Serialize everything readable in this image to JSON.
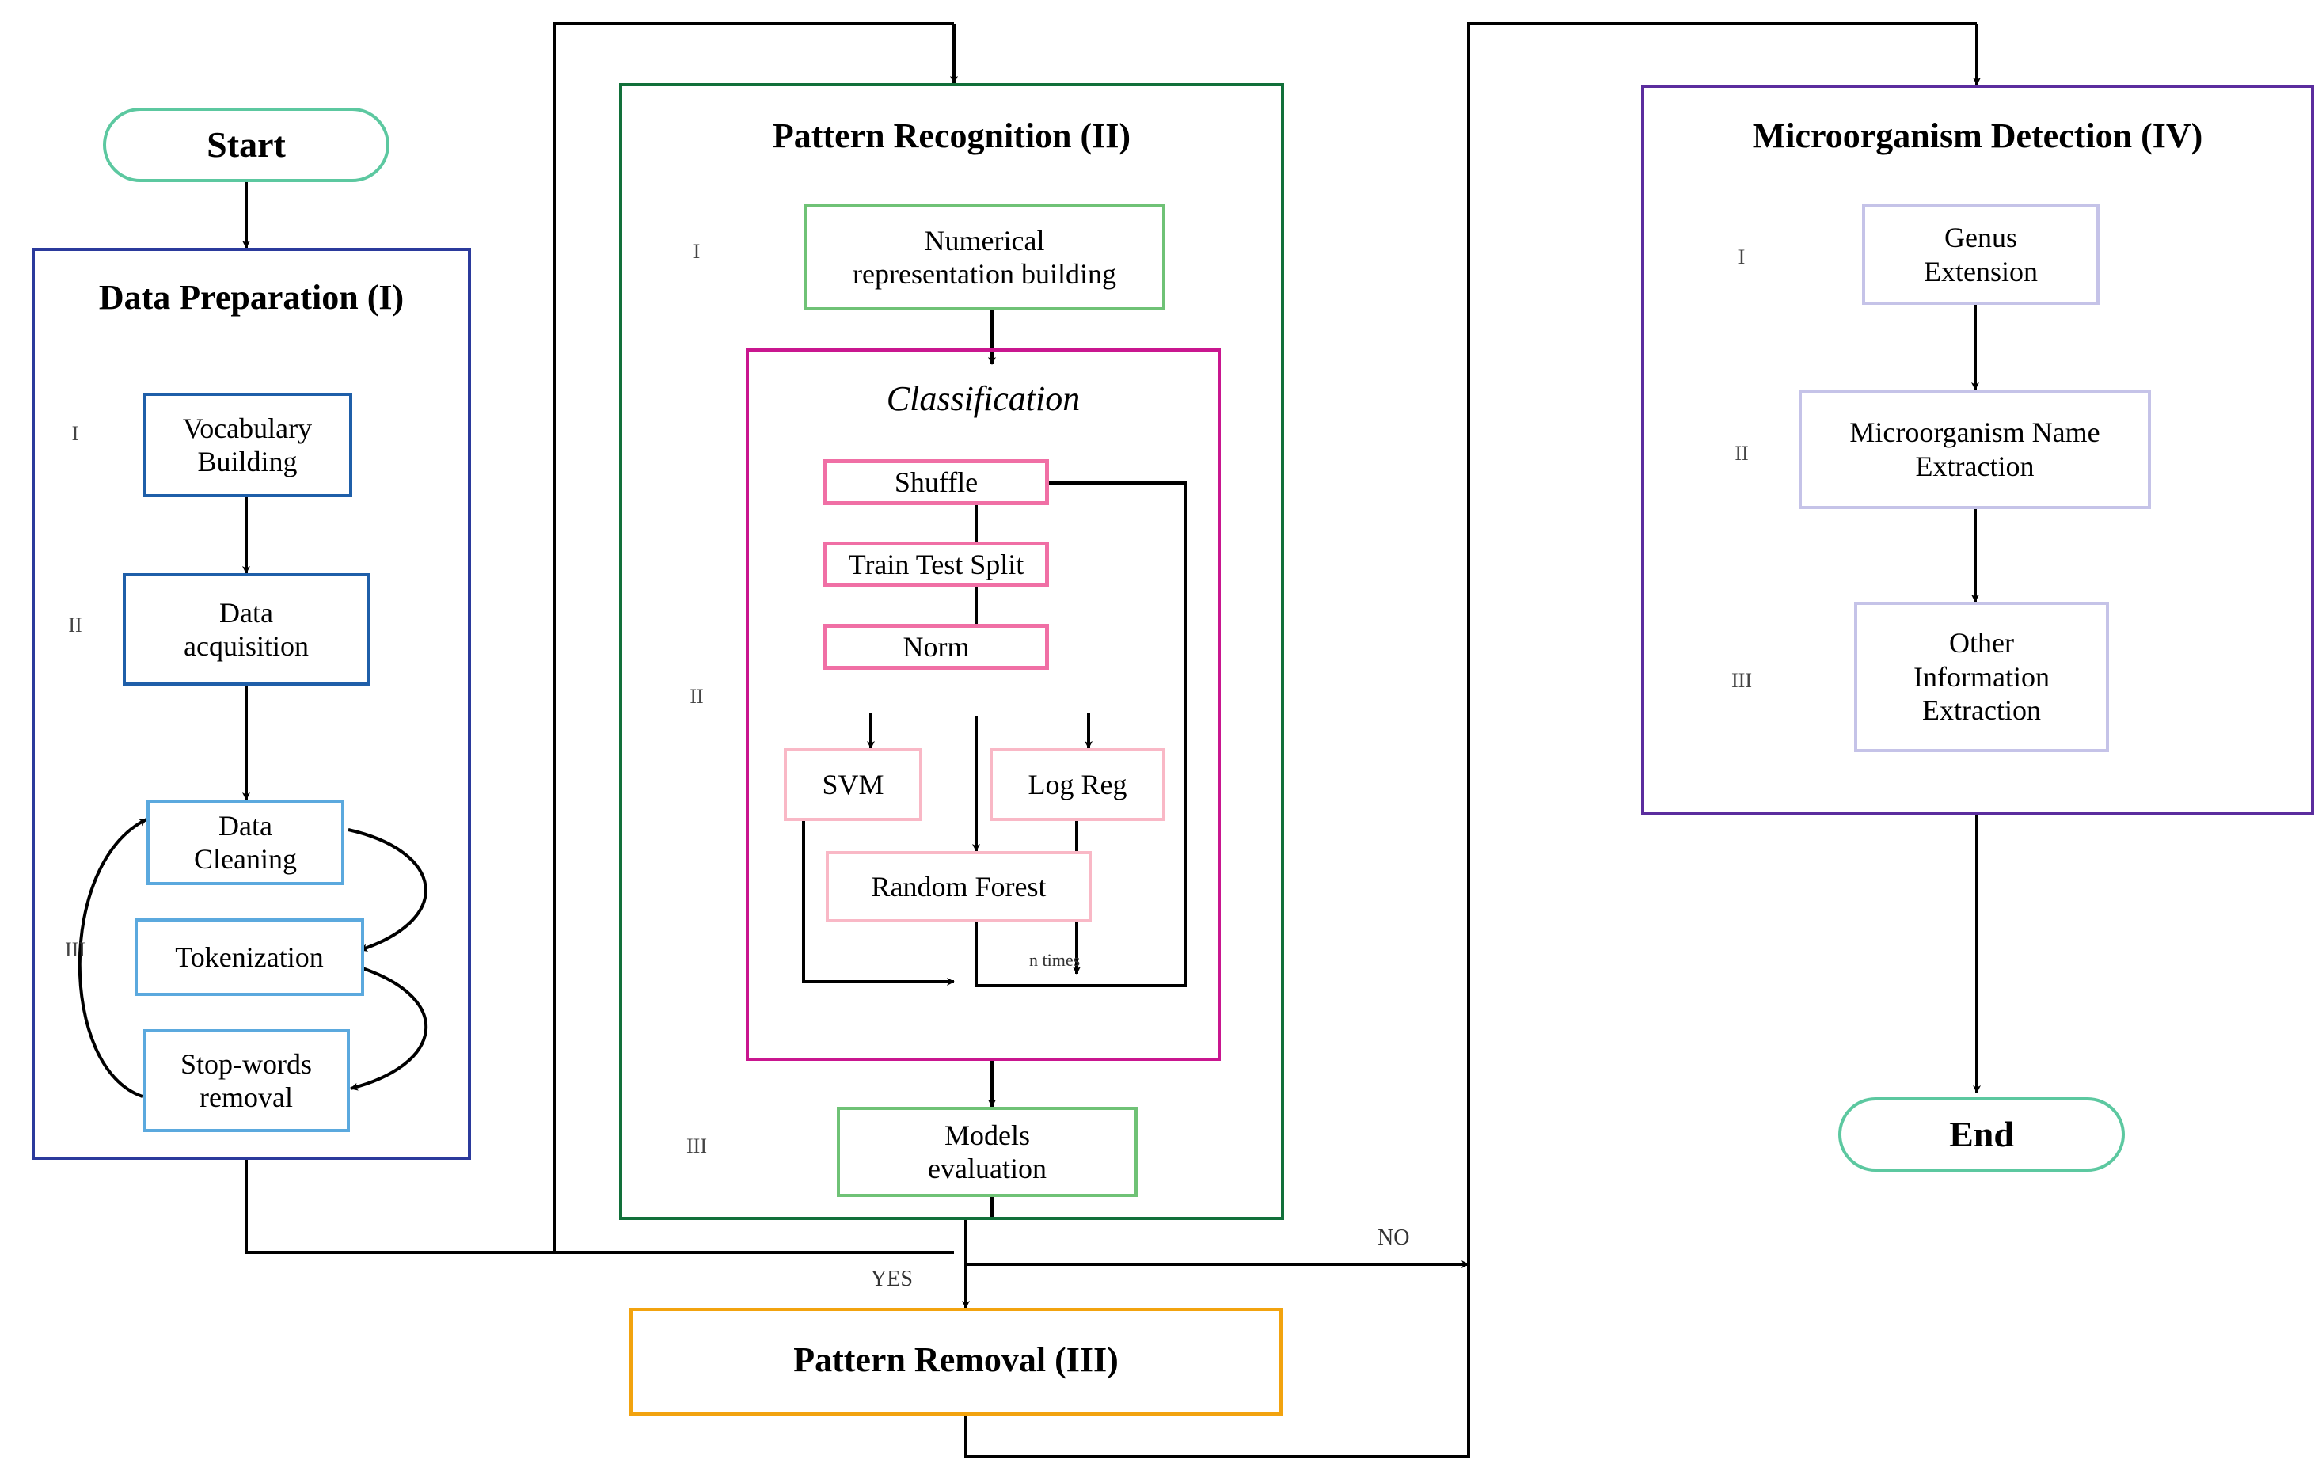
{
  "diagram": {
    "type": "flowchart",
    "title": "Microorganism detection pipeline flowchart",
    "colors": {
      "terminal_border": "#5cc8a0",
      "stage1_border": "#2b3a9c",
      "stage1_inner_dark": "#1f5fa9",
      "stage1_inner_light": "#5ba9de",
      "stage2_border": "#12703a",
      "stage2_inner": "#6fc276",
      "classification_border": "#c9168f",
      "classification_inner_strong": "#f06fa5",
      "classification_inner_light": "#f9b8c6",
      "stage3_border": "#f2a30f",
      "stage4_border": "#5b2d9e",
      "stage4_inner": "#c5c3e8",
      "wire": "#000000",
      "numeral": "#444444"
    }
  },
  "terminals": {
    "start": "Start",
    "end": "End"
  },
  "stage1": {
    "title": "Data Preparation (I)",
    "numerals": [
      "I",
      "II",
      "III"
    ],
    "nodes": {
      "vocabulary_building": "Vocabulary\nBuilding",
      "data_acquisition": "Data\nacquisition",
      "data_cleaning": "Data\nCleaning",
      "tokenization": "Tokenization",
      "stopwords_removal": "Stop-words\nremoval"
    }
  },
  "stage2": {
    "title": "Pattern Recognition (II)",
    "numerals": [
      "I",
      "II",
      "III"
    ],
    "nodes": {
      "numerical_representation": "Numerical\nrepresentation building",
      "models_evaluation": "Models\nevaluation"
    },
    "classification": {
      "title": "Classification",
      "nodes": {
        "shuffle": "Shuffle",
        "train_test_split": "Train Test Split",
        "norm": "Norm",
        "svm": "SVM",
        "log_reg": "Log Reg",
        "random_forest": "Random Forest"
      },
      "loop_label": "n times"
    }
  },
  "stage3": {
    "title": "Pattern Removal (III)"
  },
  "stage4": {
    "title": "Microorganism Detection (IV)",
    "numerals": [
      "I",
      "II",
      "III"
    ],
    "nodes": {
      "genus_extension": "Genus\nExtension",
      "microorganism_name_extraction": "Microorganism Name\nExtraction",
      "other_information_extraction": "Other\nInformation\nExtraction"
    }
  },
  "decision_labels": {
    "yes": "YES",
    "no": "NO"
  }
}
